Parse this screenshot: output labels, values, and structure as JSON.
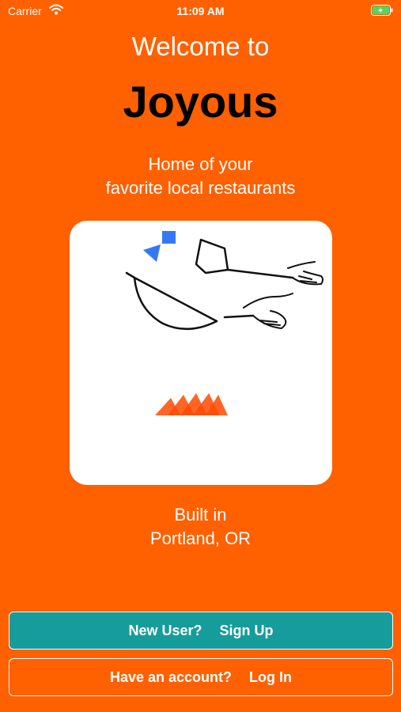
{
  "status_bar": {
    "carrier": "Carrier",
    "time": "11:09 AM",
    "icons": [
      "wifi-icon",
      "battery-charging-icon"
    ]
  },
  "welcome": {
    "line1": "Welcome to",
    "app_name": "Joyous",
    "tagline_line1": "Home of your",
    "tagline_line2": "favorite local restaurants"
  },
  "illustration": {
    "icon": "wok-cooking-illustration",
    "colors": {
      "flame": "#FF4A00",
      "accent": "#3478F6",
      "line": "#111111"
    }
  },
  "footer_note": {
    "line1": "Built in",
    "line2": "Portland, OR"
  },
  "actions": {
    "signup_prompt": "New User?",
    "signup_label": "Sign Up",
    "login_prompt": "Have an account?",
    "login_label": "Log In"
  },
  "colors": {
    "background": "#FF6000",
    "signup_button": "#169C9A",
    "title_text": "#000000"
  }
}
